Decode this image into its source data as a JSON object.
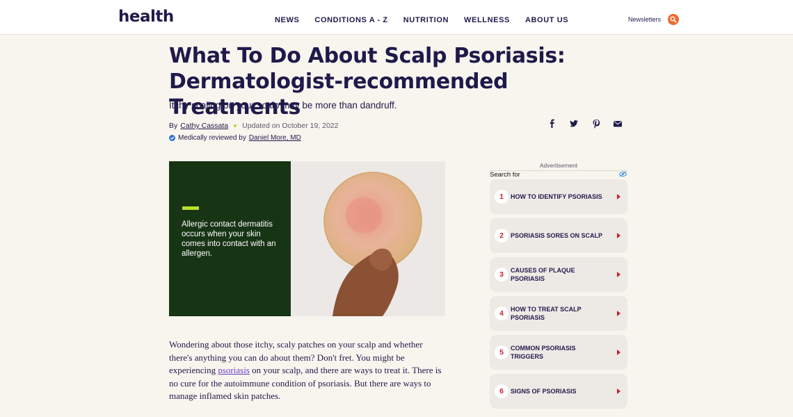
{
  "header": {
    "logo": "health",
    "nav": [
      "NEWS",
      "CONDITIONS A - Z",
      "NUTRITION",
      "WELLNESS",
      "ABOUT US"
    ],
    "newsletters": "Newsletters"
  },
  "article": {
    "title": "What To Do About Scalp Psoriasis: Dermatologist-recommended Treatments",
    "subtitle": "Itchy scaling on your scalp may be more than dandruff.",
    "by": "By",
    "author": "Cathy Cassata",
    "updated": "Updated on October 19, 2022",
    "reviewed_prefix": "Medically reviewed by",
    "reviewer": "Daniel More, MD",
    "hero_caption": "Allergic contact dermatitis occurs when your skin comes into contact with an allergen.",
    "body_before": "Wondering about those itchy, scaly patches on your scalp and whether there's anything you can do about them? Don't fret. You might be experiencing ",
    "body_link": "psoriasis",
    "body_after": " on your scalp, and there are ways to treat it. There is no cure for the autoimmune condition of psoriasis. But there are ways to manage inflamed skin patches."
  },
  "share_icons": [
    "facebook-icon",
    "twitter-icon",
    "pinterest-icon",
    "email-icon"
  ],
  "sidebar": {
    "ad_label": "Advertisement",
    "search_for": "Search for",
    "items": [
      {
        "num": "1",
        "label": "HOW TO IDENTIFY PSORIASIS"
      },
      {
        "num": "2",
        "label": "PSORIASIS SORES ON SCALP"
      },
      {
        "num": "3",
        "label": "CAUSES OF PLAQUE PSORIASIS"
      },
      {
        "num": "4",
        "label": "HOW TO TREAT SCALP PSORIASIS"
      },
      {
        "num": "5",
        "label": "COMMON PSORIASIS TRIGGERS"
      },
      {
        "num": "6",
        "label": "SIGNS OF PSORIASIS"
      }
    ]
  },
  "colors": {
    "brand": "#1f1a4a",
    "accent": "#ef6b2d",
    "hero_green": "#173414",
    "lime": "#b9e02a",
    "list_red": "#c8202a"
  }
}
